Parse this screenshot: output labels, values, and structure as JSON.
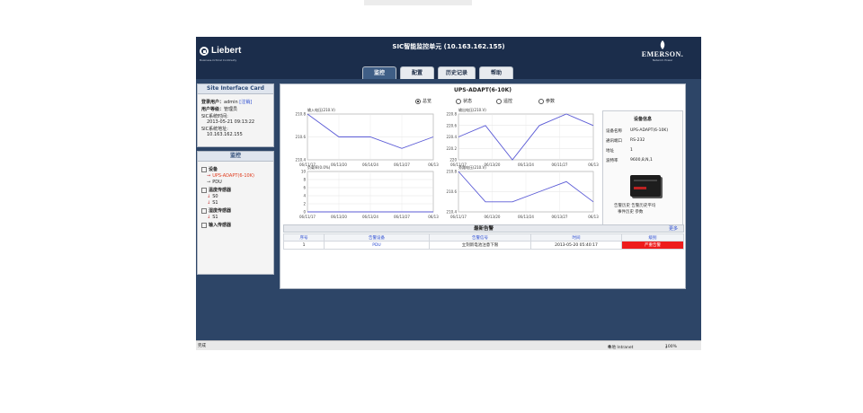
{
  "app": {
    "title": "SIC智能监控单元 (10.163.162.155)",
    "left_logo": "Liebert",
    "left_logo_tag": "Business-Critical Continuity",
    "right_logo": "EMERSON.",
    "right_logo_tag": "Network Power"
  },
  "tabs": [
    {
      "label": "监控",
      "active": true
    },
    {
      "label": "配置",
      "active": false
    },
    {
      "label": "历史记录",
      "active": false
    },
    {
      "label": "帮助",
      "active": false
    }
  ],
  "site_card": {
    "title": "Site Interface Card",
    "user_label": "登录用户：",
    "user": "admin",
    "logout": "[注销]",
    "level_label": "用户等级：",
    "level": "管理员",
    "time_label": "SIC系统时间:",
    "time": "2013-05-21 09:13:22",
    "addr_label": "SIC系统地址:",
    "addr": "10.163.162.155"
  },
  "tree": {
    "title": "监控",
    "items": [
      {
        "label": "设备",
        "type": "folder"
      },
      {
        "label": "UPS-ADAPT(6-10K)",
        "type": "device",
        "selected": true
      },
      {
        "label": "PDU",
        "type": "device"
      },
      {
        "label": "温度传感器",
        "type": "folder"
      },
      {
        "label": "S0",
        "type": "sensor"
      },
      {
        "label": "S1",
        "type": "sensor"
      },
      {
        "label": "湿度传感器",
        "type": "folder"
      },
      {
        "label": "S1",
        "type": "sensor"
      },
      {
        "label": "输入传感器",
        "type": "folder"
      }
    ]
  },
  "main": {
    "title": "UPS-ADAPT(6-10K)",
    "radios": [
      {
        "label": "总览",
        "checked": true
      },
      {
        "label": "状态",
        "checked": false
      },
      {
        "label": "遥控",
        "checked": false
      },
      {
        "label": "参数",
        "checked": false
      }
    ]
  },
  "chart_data": [
    {
      "type": "line",
      "title": "输入电压(210.V)",
      "x": [
        "06/11/17",
        "06/13/20",
        "06/14/24",
        "06/13/27",
        "06/13"
      ],
      "values": [
        210.8,
        210.6,
        210.6,
        210.5,
        210.6
      ],
      "ylim": [
        210.4,
        210.8
      ],
      "yticks": [
        210.8,
        210.6,
        210.4
      ],
      "grid": true
    },
    {
      "type": "line",
      "title": "输出电压(210.V)",
      "x": [
        "06/11/17",
        "06/13/20",
        "06/13/24",
        "06/11/27",
        "06/13"
      ],
      "values": [
        220.4,
        220.6,
        220.0,
        220.6,
        220.8,
        220.6
      ],
      "ylim": [
        220.0,
        220.8
      ],
      "yticks": [
        220.8,
        220.6,
        220.4,
        220.2,
        220.0
      ],
      "grid": true
    },
    {
      "type": "line",
      "title": "负载率(0.0%)",
      "x": [
        "06/11/17",
        "06/13/20",
        "06/13/24",
        "06/13/27",
        "06/13"
      ],
      "values": [
        0,
        0,
        0,
        0,
        0
      ],
      "ylim": [
        0,
        10
      ],
      "yticks": [
        10,
        8,
        6,
        4,
        2,
        0
      ],
      "grid": true
    },
    {
      "type": "line",
      "title": "旁路电压(210.V)",
      "x": [
        "06/11/17",
        "06/13/20",
        "06/13/24",
        "06/13/27",
        "06/13"
      ],
      "values": [
        210.8,
        210.5,
        210.5,
        210.6,
        210.7,
        210.5
      ],
      "ylim": [
        210.4,
        210.8
      ],
      "yticks": [
        210.8,
        210.6,
        210.4
      ],
      "grid": true
    }
  ],
  "info": {
    "title": "设备信息",
    "rows": [
      {
        "k": "设备名称",
        "v": "UPS-ADAPT(6-10K)"
      },
      {
        "k": "通讯端口",
        "v": "RS-232"
      },
      {
        "k": "地址",
        "v": "1"
      },
      {
        "k": "波特率",
        "v": "9600,8,N,1"
      }
    ],
    "links": [
      "告警历史  告警历史平均",
      "事件历史  参数"
    ]
  },
  "alarms": {
    "title": "最新告警",
    "more": "更多",
    "columns": [
      "序号",
      "告警设备",
      "告警信号",
      "时间",
      "级别"
    ],
    "rows": [
      {
        "no": "1",
        "device": "PDU",
        "signal": "立刻新电池注意下限",
        "time": "2013-05-20 05:40:17",
        "level": "严重告警"
      }
    ]
  },
  "statusbar": {
    "left": "完成",
    "zone": "本地 Intranet",
    "zoom": "100%"
  }
}
